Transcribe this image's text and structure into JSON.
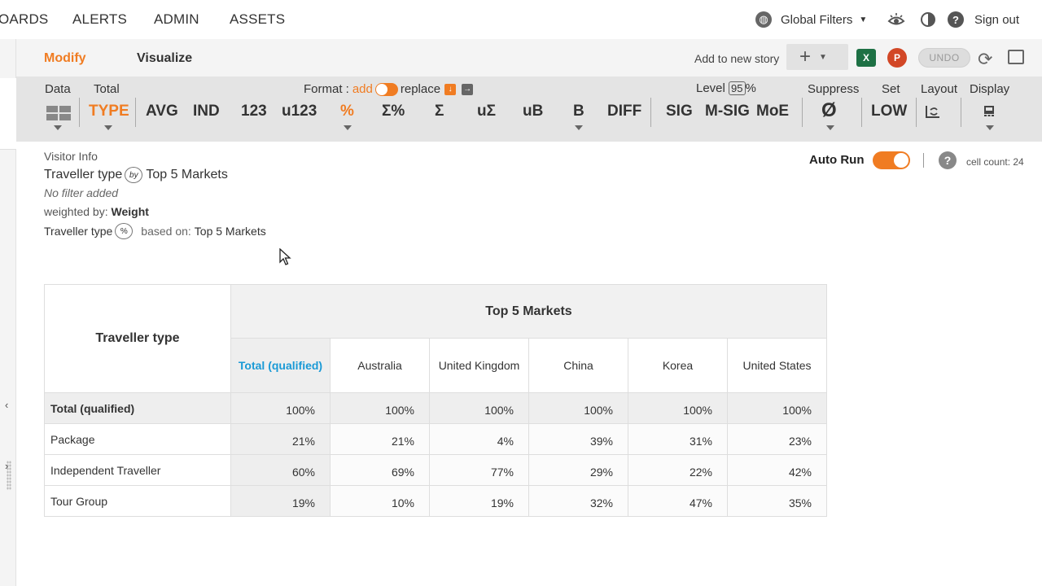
{
  "nav": {
    "items": [
      "OARDS",
      "ALERTS",
      "ADMIN",
      "ASSETS"
    ],
    "global_filters": "Global Filters",
    "sign_out": "Sign out"
  },
  "modbar": {
    "tab_modify": "Modify",
    "tab_visualize": "Visualize",
    "add_story": "Add to new story",
    "undo": "UNDO"
  },
  "toolbar": {
    "data_label": "Data",
    "total_label": "Total",
    "format_label": "Format :",
    "format_add": "add",
    "format_replace": "replace",
    "level_label": "Level",
    "level_value": "95",
    "level_pct": "%",
    "suppress_label": "Suppress",
    "set_label": "Set",
    "layout_label": "Layout",
    "display_label": "Display",
    "btn_type": "TYPE",
    "btn_avg": "AVG",
    "btn_ind": "IND",
    "btn_123": "123",
    "btn_u123": "u123",
    "btn_pct": "%",
    "btn_sum_pct": "Σ%",
    "btn_sum": "Σ",
    "btn_usum": "uΣ",
    "btn_ub": "uB",
    "btn_b": "B",
    "btn_diff": "DIFF",
    "btn_sig": "SIG",
    "btn_msig": "M-SIG",
    "btn_moe": "MoE",
    "btn_suppress": "Ø",
    "btn_low": "LOW"
  },
  "info": {
    "visitor_info": "Visitor Info",
    "row_var": "Traveller type",
    "by_badge": "by",
    "col_var": "Top 5 Markets",
    "no_filter": "No filter added",
    "weighted_prefix": "weighted by:",
    "weighted_value": "Weight",
    "pct_var": "Traveller type",
    "pct_badge": "%",
    "based_on": "based on:",
    "based_value": "Top 5 Markets"
  },
  "autorun": {
    "label": "Auto Run",
    "cell_count": "cell count: 24"
  },
  "table": {
    "row_title": "Traveller type",
    "col_title": "Top 5 Markets",
    "columns": [
      "Total (qualified)",
      "Australia",
      "United Kingdom",
      "China",
      "Korea",
      "United States"
    ],
    "rows": [
      {
        "label": "Total (qualified)",
        "values": [
          "100%",
          "100%",
          "100%",
          "100%",
          "100%",
          "100%"
        ]
      },
      {
        "label": "Package",
        "values": [
          "21%",
          "21%",
          "4%",
          "39%",
          "31%",
          "23%"
        ]
      },
      {
        "label": "Independent Traveller",
        "values": [
          "60%",
          "69%",
          "77%",
          "29%",
          "22%",
          "42%"
        ]
      },
      {
        "label": "Tour Group",
        "values": [
          "19%",
          "10%",
          "19%",
          "32%",
          "47%",
          "35%"
        ]
      }
    ]
  },
  "colors": {
    "accent": "#f07c22",
    "link_blue": "#1a9ad6"
  }
}
